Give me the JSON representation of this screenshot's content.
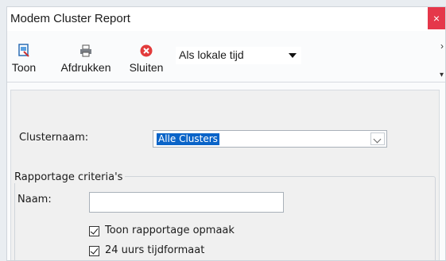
{
  "window": {
    "title": "Modem Cluster Report",
    "close_glyph": "×"
  },
  "toolbar": {
    "buttons": [
      {
        "label": "Toon",
        "icon": "report-icon"
      },
      {
        "label": "Afdrukken",
        "icon": "printer-icon"
      },
      {
        "label": "Sluiten",
        "icon": "close-circle-icon"
      }
    ],
    "timezone_value": "Als lokale tijd",
    "overflow_glyph_top": "›",
    "overflow_glyph_bottom": "▾"
  },
  "form": {
    "cluster_label": "Clusternaam:",
    "cluster_value": "Alle Clusters",
    "criteria_legend": "Rapportage criteria's",
    "name_label": "Naam:",
    "name_value": "",
    "show_format_label": "Toon rapportage opmaak",
    "show_format_checked": true,
    "hour24_label": "24 uurs tijdformaat",
    "hour24_checked": true
  }
}
